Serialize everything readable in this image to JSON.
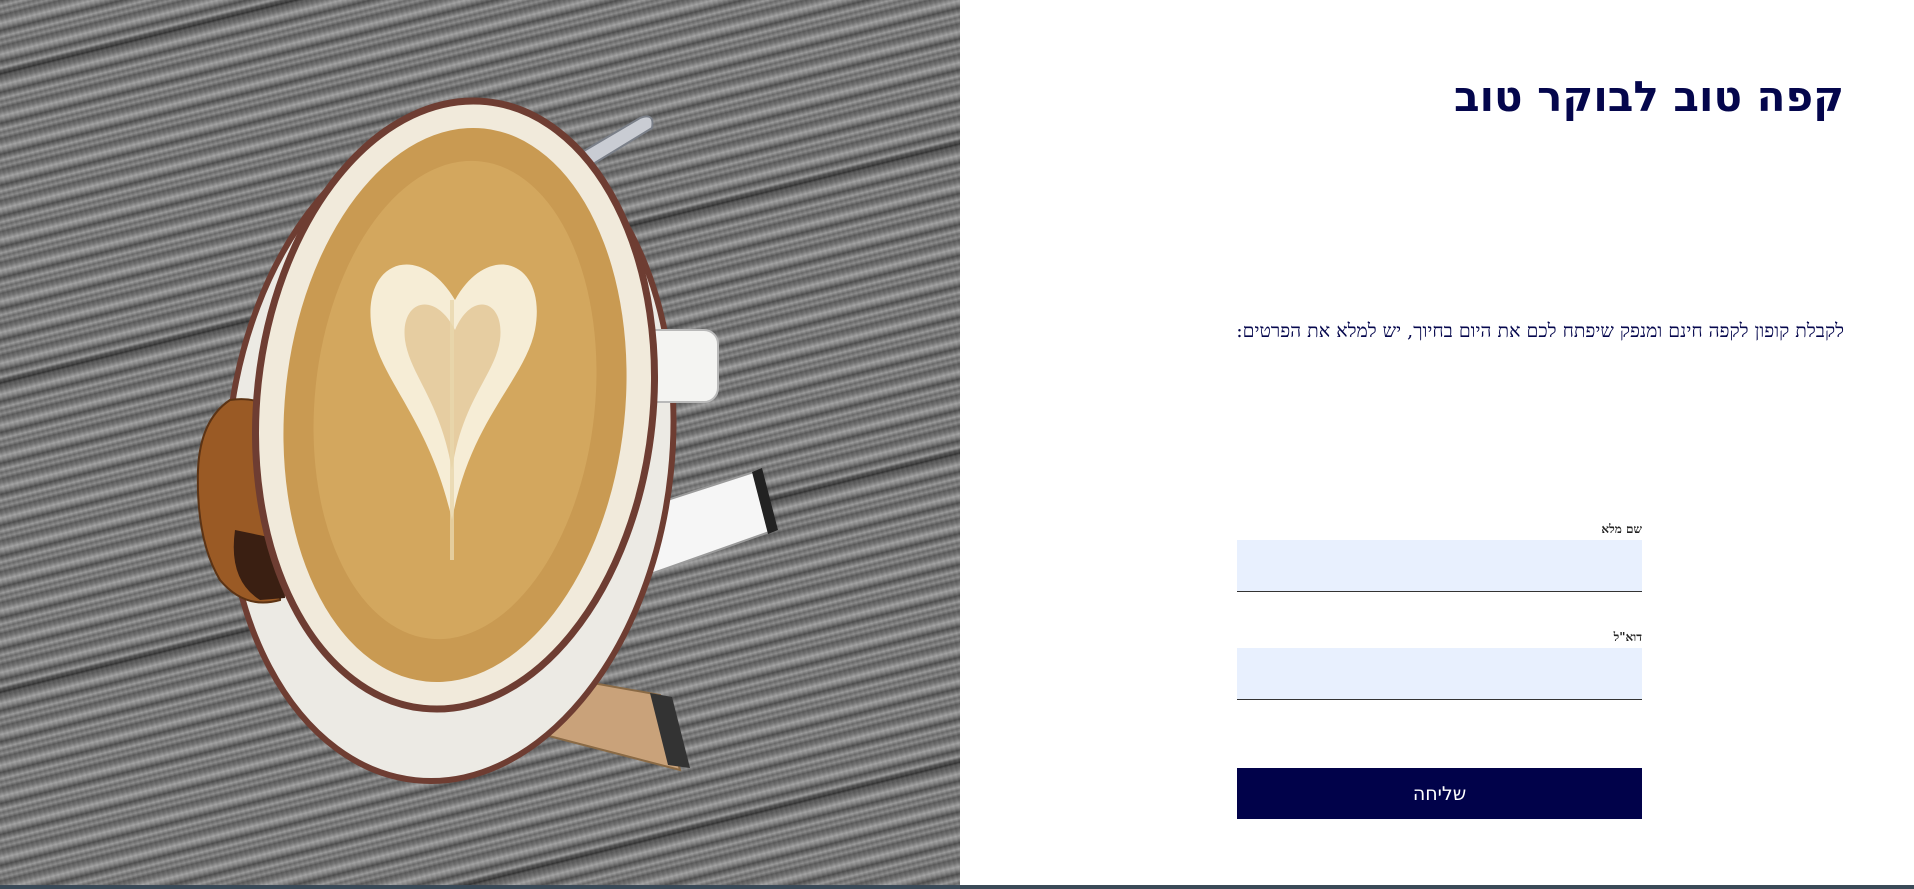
{
  "hero_image": {
    "subject": "coffee-cup-latte-art",
    "colors": {
      "wood": "#707070",
      "saucer": "#e9e6e0",
      "cup_rim": "#6e3d32",
      "coffee": "#c99a52",
      "foam": "#f5ead2",
      "biscuit": "#9a5a25",
      "sugar_stick": "#ffffff",
      "spoon": "#c4b3a0"
    }
  },
  "page": {
    "headline": "קפה טוב לבוקר טוב",
    "intro": "לקבלת קופון לקפה חינם ומנפק שיפתח לכם את היום בחיוך, יש למלא את הפרטים:"
  },
  "form": {
    "name_label": "שם מלא",
    "name_value": "",
    "email_label": "דוא\"ל",
    "email_value": "",
    "submit_label": "שליחה"
  },
  "colors": {
    "accent": "#01024a",
    "heading": "#04064c",
    "input_bg": "#e8f0fe"
  }
}
